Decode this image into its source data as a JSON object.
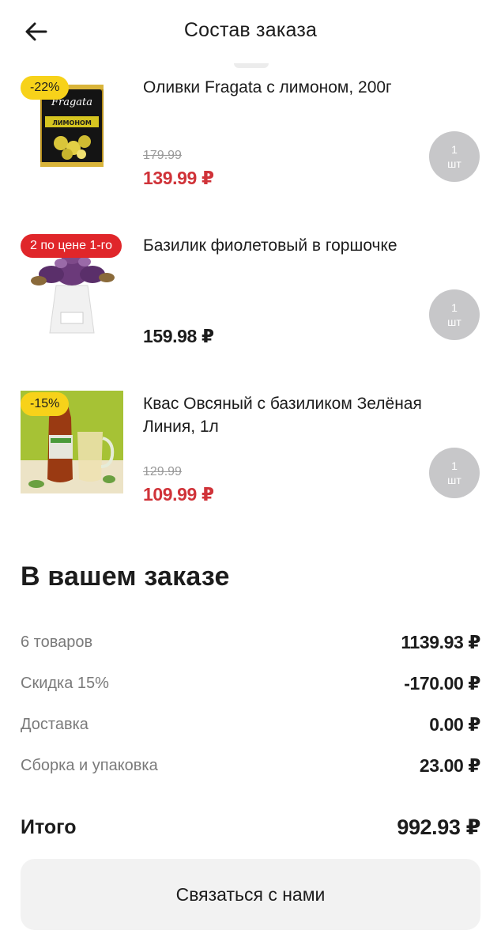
{
  "header": {
    "title": "Состав заказа",
    "back_icon": "arrow-left-icon"
  },
  "items": [
    {
      "name": "Оливки Fragata с лимоном, 200г",
      "badge": "-22%",
      "badge_color": "#f7d21a",
      "old_price": "179.99",
      "price": "139.99 ₽",
      "qty_value": "1",
      "qty_unit": "шт",
      "image": "olives-can-image",
      "brand_text": "Fragata",
      "can_label": "ЛИМОНОМ"
    },
    {
      "name": "Базилик фиолетовый в горшочке",
      "badge": "2 по цене 1-го",
      "badge_color": "#e0262a",
      "old_price": "",
      "price": "159.98 ₽",
      "qty_value": "1",
      "qty_unit": "шт",
      "image": "basil-pot-image"
    },
    {
      "name": "Квас Овсяный с базиликом Зелёная Линия, 1л",
      "badge": "-15%",
      "badge_color": "#f7d21a",
      "old_price": "129.99",
      "price": "109.99 ₽",
      "qty_value": "1",
      "qty_unit": "шт",
      "image": "kvass-bottle-image"
    }
  ],
  "summary": {
    "title": "В вашем заказе",
    "rows": [
      {
        "label": "6 товаров",
        "value": "1139.93 ₽"
      },
      {
        "label": "Скидка 15%",
        "value": "-170.00 ₽"
      },
      {
        "label": "Доставка",
        "value": "0.00 ₽"
      },
      {
        "label": "Сборка и упаковка",
        "value": "23.00 ₽"
      }
    ],
    "total_label": "Итого",
    "total_value": "992.93 ₽"
  },
  "contact_button": "Связаться с нами",
  "colors": {
    "discount_red": "#d03339",
    "badge_yellow": "#f7d21a",
    "badge_red": "#e0262a",
    "qty_grey": "#c7c7c9"
  }
}
